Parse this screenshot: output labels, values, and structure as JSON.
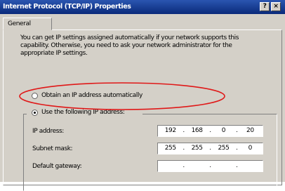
{
  "window": {
    "title": "Internet Protocol (TCP/IP) Properties",
    "help": "?",
    "close": "×"
  },
  "tabs": [
    "General"
  ],
  "description": "You can get IP settings assigned automatically if your network supports this capability. Otherwise, you need to ask your network administrator for the appropriate IP settings.",
  "options": {
    "auto": {
      "label": "Obtain an IP address automatically",
      "checked": false
    },
    "manual": {
      "label": "Use the following IP address:",
      "checked": true
    }
  },
  "fields": [
    {
      "label": "IP address:",
      "octets": [
        "192",
        "168",
        "0",
        "20"
      ]
    },
    {
      "label": "Subnet mask:",
      "octets": [
        "255",
        "255",
        "255",
        "0"
      ]
    },
    {
      "label": "Default gateway:",
      "octets": [
        "",
        "",
        "",
        ""
      ]
    }
  ],
  "colors": {
    "highlight_ellipse": "#e01818",
    "titlebar": "#0a2a7a"
  }
}
